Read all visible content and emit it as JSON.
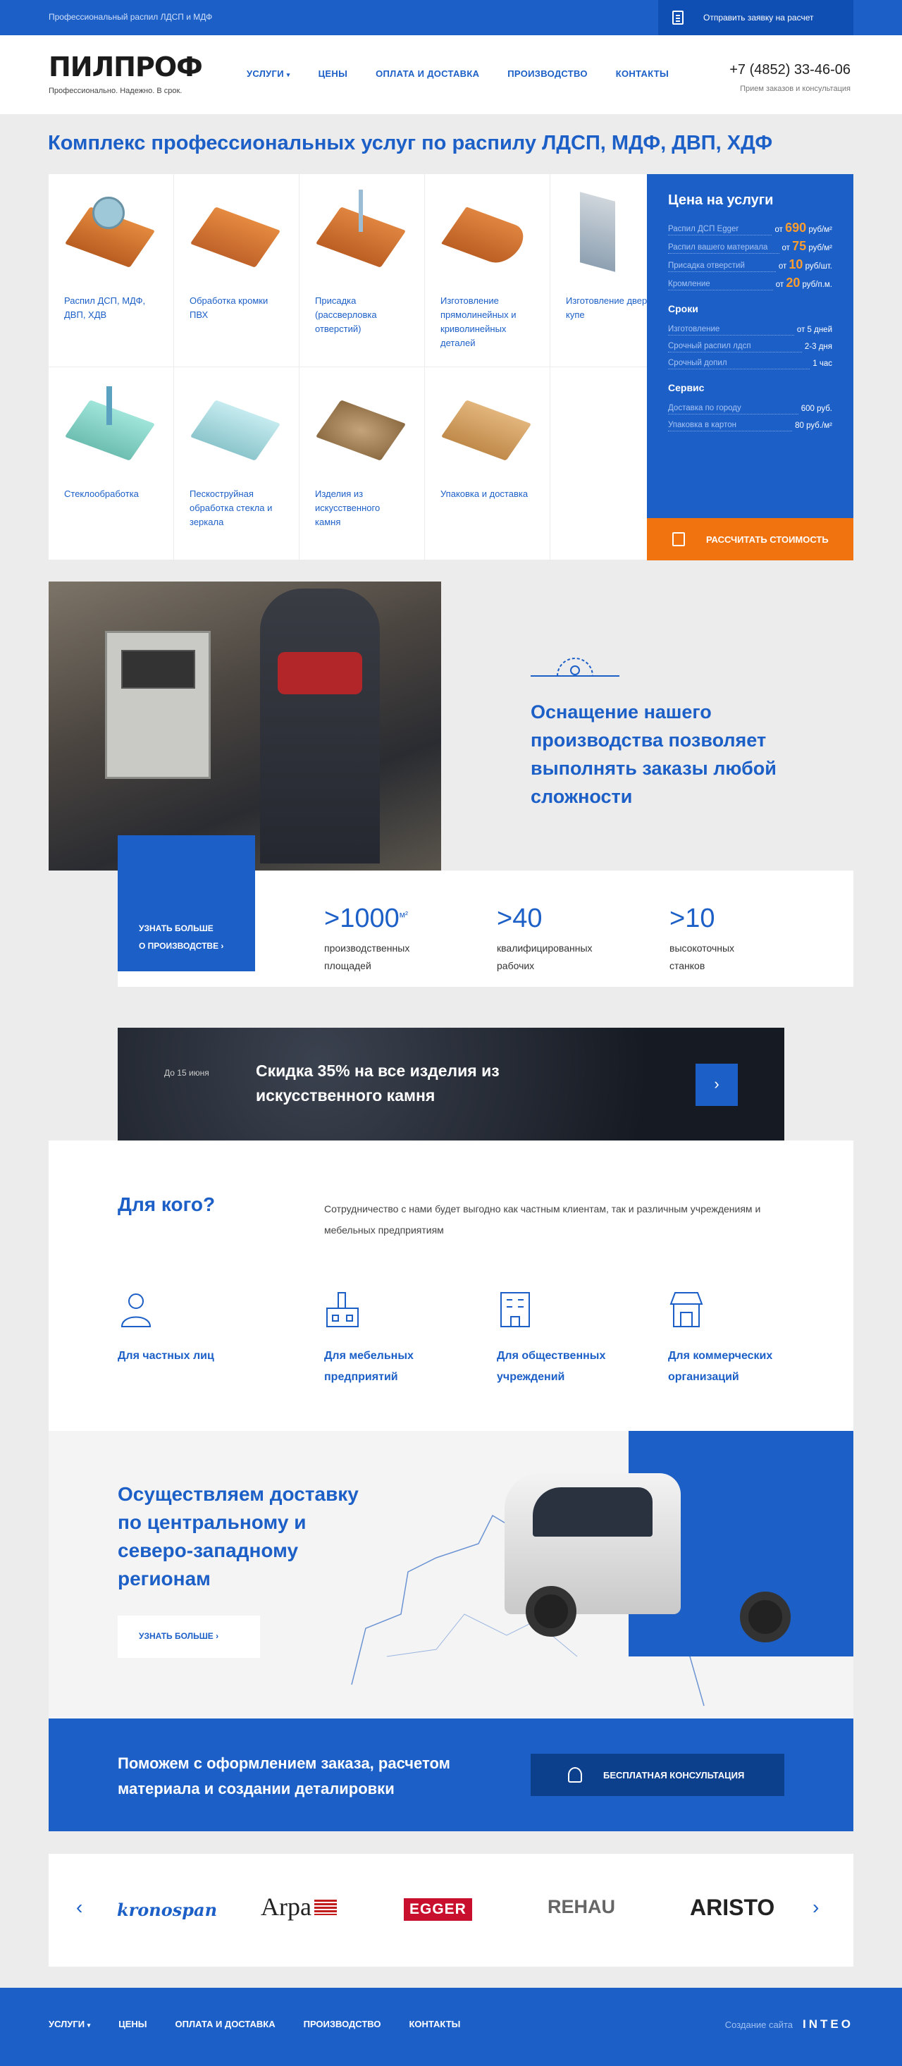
{
  "topbar": {
    "tagline": "Профессиональный распил ЛДСП и МДФ",
    "request": "Отправить заявку на расчет"
  },
  "header": {
    "logo": "ПИЛПРОФ",
    "slogan": "Профессионально. Надежно. В срок.",
    "phone": "+7 (4852) 33-46-06",
    "phone_note": "Прием заказов и консультация"
  },
  "nav": [
    "УСЛУГИ",
    "ЦЕНЫ",
    "ОПЛАТА И ДОСТАВКА",
    "ПРОИЗВОДСТВО",
    "КОНТАКТЫ"
  ],
  "services": {
    "title": "Комплекс профессиональных услуг по распилу ЛДСП, МДФ, ДВП, ХДФ",
    "items": [
      "Распил ДСП, МДФ, ДВП, ХДВ",
      "Обработка кромки ПВХ",
      "Присадка (рассверловка отверстий)",
      "Изготовление прямолинейных и криволинейных деталей",
      "Изготовление дверей купе",
      "Стеклообработка",
      "Пескоструйная обработка стекла и зеркала",
      "Изделия из искусственного камня",
      "Упаковка и доставка"
    ]
  },
  "price": {
    "title": "Цена на услуги",
    "rows": [
      {
        "name": "Распил ДСП Egger",
        "pre": "от ",
        "num": "690",
        "unit": " руб/м²"
      },
      {
        "name": "Распил вашего материала",
        "pre": "от ",
        "num": "75",
        "unit": " руб/м²"
      },
      {
        "name": "Присадка отверстий",
        "pre": "от ",
        "num": "10",
        "unit": " руб/шт."
      },
      {
        "name": "Кромление",
        "pre": "от ",
        "num": "20",
        "unit": " руб/п.м."
      }
    ],
    "terms_title": "Сроки",
    "terms": [
      {
        "name": "Изготовление",
        "value": "от 5 дней"
      },
      {
        "name": "Срочный распил лдсп",
        "value": "2-3 дня"
      },
      {
        "name": "Срочный допил",
        "value": "1 час"
      }
    ],
    "service_title": "Сервис",
    "service": [
      {
        "name": "Доставка по городу",
        "value": "600 руб."
      },
      {
        "name": "Упаковка в картон",
        "value": "80 руб./м²"
      }
    ],
    "calc": "РАССЧИТАТЬ СТОИМОСТЬ"
  },
  "production": {
    "headline": "Оснащение нашего производства позволяет выполнять заказы любой сложности",
    "learn_1": "УЗНАТЬ БОЛЬШЕ",
    "learn_2": "О ПРОИЗВОДСТВЕ",
    "stats": [
      {
        "big": ">1000",
        "sup": "м²",
        "text": "производственных площадей"
      },
      {
        "big": ">40",
        "sup": "",
        "text": "квалифицированных рабочих"
      },
      {
        "big": ">10",
        "sup": "",
        "text": "высокоточных станков"
      }
    ]
  },
  "promo": {
    "date": "До 15 июня",
    "text": "Скидка 35% на все изделия из искусственного камня"
  },
  "who": {
    "title": "Для кого?",
    "text": "Сотрудничество с нами будет выгодно как частным клиентам, так и различным учреждениям и мебельных предприятиям",
    "items": [
      {
        "label": "Для частных лиц",
        "icon": "person-icon"
      },
      {
        "label": "Для мебельных предприятий",
        "icon": "factory-icon"
      },
      {
        "label": "Для общественных учреждений",
        "icon": "building-icon"
      },
      {
        "label": "Для коммерческих организаций",
        "icon": "shop-icon"
      }
    ]
  },
  "delivery": {
    "title": "Осуществляем доставку по центральному и северо-западному регионам",
    "button": "УЗНАТЬ БОЛЬШЕ"
  },
  "consult": {
    "text": "Поможем с оформлением заказа, расчетом материала и создании деталировки",
    "button": "БЕСПЛАТНАЯ КОНСУЛЬТАЦИЯ"
  },
  "partners": [
    "kronospan",
    "Arpa",
    "EGGER",
    "REHAU",
    "ARISTO"
  ],
  "footer": {
    "nav": [
      "УСЛУГИ",
      "ЦЕНЫ",
      "ОПЛАТА И ДОСТАВКА",
      "ПРОИЗВОДСТВО",
      "КОНТАКТЫ"
    ],
    "made": "Создание сайта",
    "studio": "INTEO"
  },
  "colors": {
    "brand": "#1c5fc7",
    "accent": "#f0730f",
    "price_highlight": "#ff9d2e"
  }
}
